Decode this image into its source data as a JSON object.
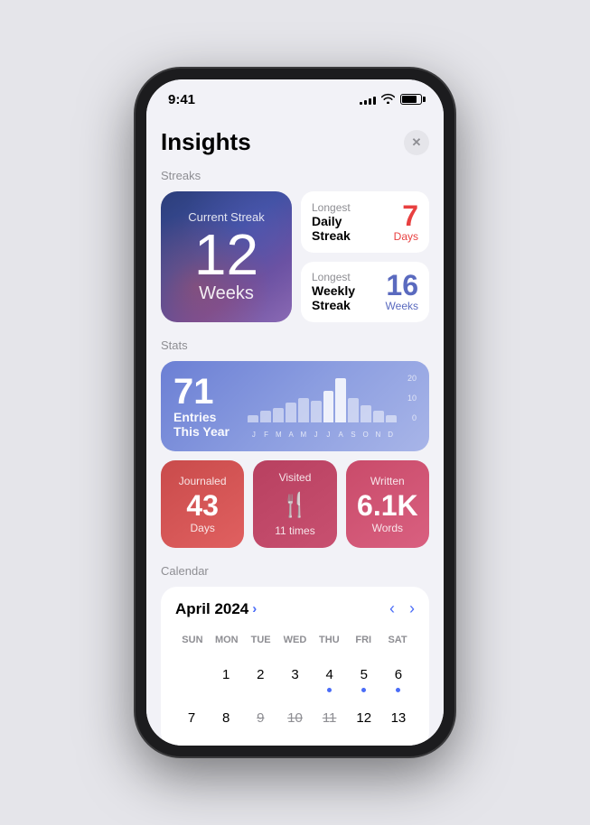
{
  "statusBar": {
    "time": "9:41",
    "signal": [
      3,
      5,
      7,
      9,
      11
    ],
    "battery_percent": 80
  },
  "header": {
    "title": "Insights",
    "close_label": "✕"
  },
  "streaks": {
    "section_label": "Streaks",
    "current": {
      "label": "Current Streak",
      "value": "12",
      "unit": "Weeks"
    },
    "longest_daily": {
      "top": "Longest",
      "bold": "Daily\nStreak",
      "bold1": "Daily",
      "bold2": "Streak",
      "value": "7",
      "unit": "Days"
    },
    "longest_weekly": {
      "top": "Longest",
      "bold": "Weekly\nStreak",
      "bold1": "Weekly",
      "bold2": "Streak",
      "value": "16",
      "unit": "Weeks"
    }
  },
  "stats": {
    "section_label": "Stats",
    "entries": {
      "number": "71",
      "label1": "Entries",
      "label2": "This Year"
    },
    "chart": {
      "y_labels": [
        "20",
        "10",
        "0"
      ],
      "months": [
        "J",
        "F",
        "M",
        "A",
        "M",
        "J",
        "J",
        "A",
        "S",
        "O",
        "N",
        "D"
      ],
      "bars": [
        3,
        5,
        6,
        8,
        10,
        9,
        13,
        18,
        10,
        7,
        5,
        3
      ]
    },
    "journaled": {
      "top_label": "Journaled",
      "number": "43",
      "bottom_label": "Days"
    },
    "visited": {
      "top_label": "Visited",
      "icon": "🍴",
      "bottom_label": "11 times"
    },
    "written": {
      "top_label": "Written",
      "number": "6.1K",
      "bottom_label": "Words"
    }
  },
  "calendar": {
    "section_label": "Calendar",
    "month": "April 2024",
    "chevron": "›",
    "nav_prev": "‹",
    "nav_next": "›",
    "day_headers": [
      "SUN",
      "MON",
      "TUE",
      "WED",
      "THU",
      "FRI",
      "SAT"
    ],
    "weeks": [
      [
        {
          "day": "1",
          "dot": false,
          "today": false,
          "strike": false
        },
        {
          "day": "2",
          "dot": false,
          "today": false,
          "strike": false
        },
        {
          "day": "3",
          "dot": false,
          "today": false,
          "strike": false
        },
        {
          "day": "4",
          "dot": false,
          "today": false,
          "strike": false
        },
        {
          "day": "5",
          "dot": true,
          "today": false,
          "strike": false
        },
        {
          "day": "6",
          "dot": true,
          "today": false,
          "strike": false
        },
        {
          "day": "7",
          "dot": true,
          "today": false,
          "strike": false
        }
      ],
      [
        {
          "day": "7",
          "dot": false,
          "today": false,
          "strike": false
        },
        {
          "day": "8",
          "dot": false,
          "today": false,
          "strike": false
        },
        {
          "day": "9",
          "dot": false,
          "today": false,
          "strike": true
        },
        {
          "day": "10",
          "dot": false,
          "today": false,
          "strike": true
        },
        {
          "day": "11",
          "dot": false,
          "today": false,
          "strike": true
        },
        {
          "day": "12",
          "dot": false,
          "today": false,
          "strike": false
        },
        {
          "day": "13",
          "dot": false,
          "today": false,
          "strike": false
        }
      ]
    ],
    "first_row_start": 0
  }
}
